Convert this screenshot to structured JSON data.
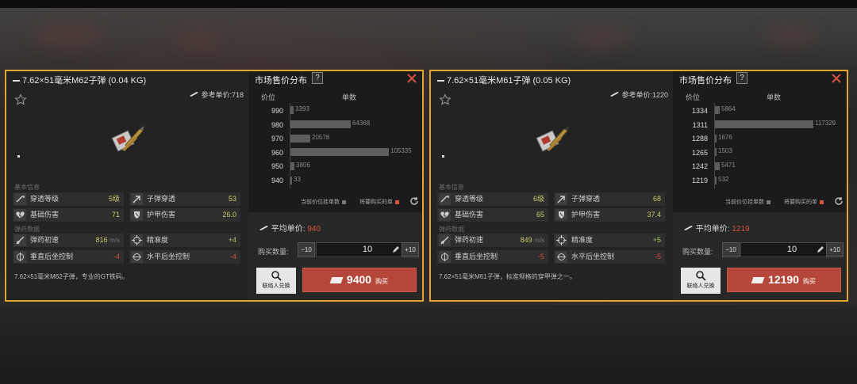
{
  "panels": [
    {
      "title": "7.62×51毫米M62子弹 (0.04 KG)",
      "ref_price_label": "参考单价:",
      "ref_price": "718",
      "stats_basic_label": "基本信息",
      "stats_bullet_label": "弹药数据",
      "stats": {
        "penetration_level": {
          "label": "穿透等级",
          "value": "5级"
        },
        "bullet_penetration": {
          "label": "子弹穿透",
          "value": "53"
        },
        "base_damage": {
          "label": "基础伤害",
          "value": "71"
        },
        "armor_damage": {
          "label": "护甲伤害",
          "value": "26.0"
        },
        "muzzle_velocity": {
          "label": "弹药初速",
          "value": "816",
          "unit": "m/s"
        },
        "accuracy": {
          "label": "精准度",
          "value": "+4"
        },
        "vertical_recoil": {
          "label": "垂直后坐控制",
          "value": "-4"
        },
        "horizontal_recoil": {
          "label": "水平后坐控制",
          "value": "-4"
        }
      },
      "description": "7.62×51毫米M62子弹，专业的GT铁码。",
      "market": {
        "title": "市场售价分布",
        "help": "?",
        "col_price": "价位",
        "col_quantity": "单数",
        "prices": [
          "990",
          "980",
          "970",
          "960",
          "950",
          "940"
        ],
        "quantities": [
          "3393",
          "64368",
          "20578",
          "105335",
          "3806",
          "33"
        ],
        "bar_ratios": [
          0.03,
          0.61,
          0.2,
          1.0,
          0.04,
          0.003
        ],
        "legend_current": "当前价位挂单数",
        "legend_target": "将要购买的单"
      },
      "trade": {
        "avg_label": "平均单价:",
        "avg_value": "940",
        "qty_label": "购买数量:",
        "minus10": "−10",
        "qty": "10",
        "plus10": "+10",
        "subscribe": "联络人兑换",
        "buy_total": "9400",
        "buy_label": "购买"
      }
    },
    {
      "title": "7.62×51毫米M61子弹 (0.05 KG)",
      "ref_price_label": "参考单价:",
      "ref_price": "1220",
      "stats_basic_label": "基本信息",
      "stats_bullet_label": "弹药数据",
      "stats": {
        "penetration_level": {
          "label": "穿透等级",
          "value": "6级"
        },
        "bullet_penetration": {
          "label": "子弹穿透",
          "value": "68"
        },
        "base_damage": {
          "label": "基础伤害",
          "value": "65"
        },
        "armor_damage": {
          "label": "护甲伤害",
          "value": "37.4"
        },
        "muzzle_velocity": {
          "label": "弹药初速",
          "value": "849",
          "unit": "m/s"
        },
        "accuracy": {
          "label": "精准度",
          "value": "+5"
        },
        "vertical_recoil": {
          "label": "垂直后坐控制",
          "value": "-5"
        },
        "horizontal_recoil": {
          "label": "水平后坐控制",
          "value": "-5"
        }
      },
      "description": "7.62×51毫米M61子弹，标准规格的穿甲弹之一。",
      "market": {
        "title": "市场售价分布",
        "help": "?",
        "col_price": "价位",
        "col_quantity": "单数",
        "prices": [
          "1334",
          "1311",
          "1288",
          "1265",
          "1242",
          "1219"
        ],
        "quantities": [
          "5864",
          "117329",
          "1676",
          "1503",
          "5471",
          "532"
        ],
        "bar_ratios": [
          0.05,
          1.0,
          0.014,
          0.013,
          0.047,
          0.005
        ],
        "legend_current": "当前价位挂单数",
        "legend_target": "将要购买的单"
      },
      "trade": {
        "avg_label": "平均单价:",
        "avg_value": "1219",
        "qty_label": "购买数量:",
        "minus10": "−10",
        "qty": "10",
        "plus10": "+10",
        "subscribe": "联络人兑换",
        "buy_total": "12190",
        "buy_label": "购买"
      }
    }
  ],
  "colors": {
    "border": "#e2a530",
    "buy": "#b5473a",
    "avg_price": "#d65540"
  }
}
